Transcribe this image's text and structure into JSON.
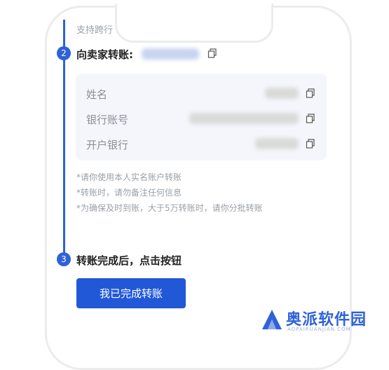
{
  "top_partial_text": "支持跨行",
  "step2": {
    "number": "2",
    "title": "向卖家转账:"
  },
  "card": {
    "rows": [
      {
        "label": "姓名"
      },
      {
        "label": "银行账号"
      },
      {
        "label": "开户银行"
      }
    ]
  },
  "notes": [
    "*请你使用本人实名账户转账",
    "*转账时，请勿备注任何信息",
    "*为确保及时到账，大于5万转账时，请你分批转账"
  ],
  "step3": {
    "number": "3",
    "title": "转账完成后，点击按钮"
  },
  "done_button": "我已完成转账",
  "watermark": {
    "title": "奥派软件园",
    "subtitle": "AOPAIRUANJIAN.COM"
  },
  "colors": {
    "accent": "#2e62d9",
    "button": "#2158d8",
    "card_bg": "#f4f6fb"
  },
  "icons": {
    "copy": "copy-icon",
    "logo": "logo-icon"
  }
}
